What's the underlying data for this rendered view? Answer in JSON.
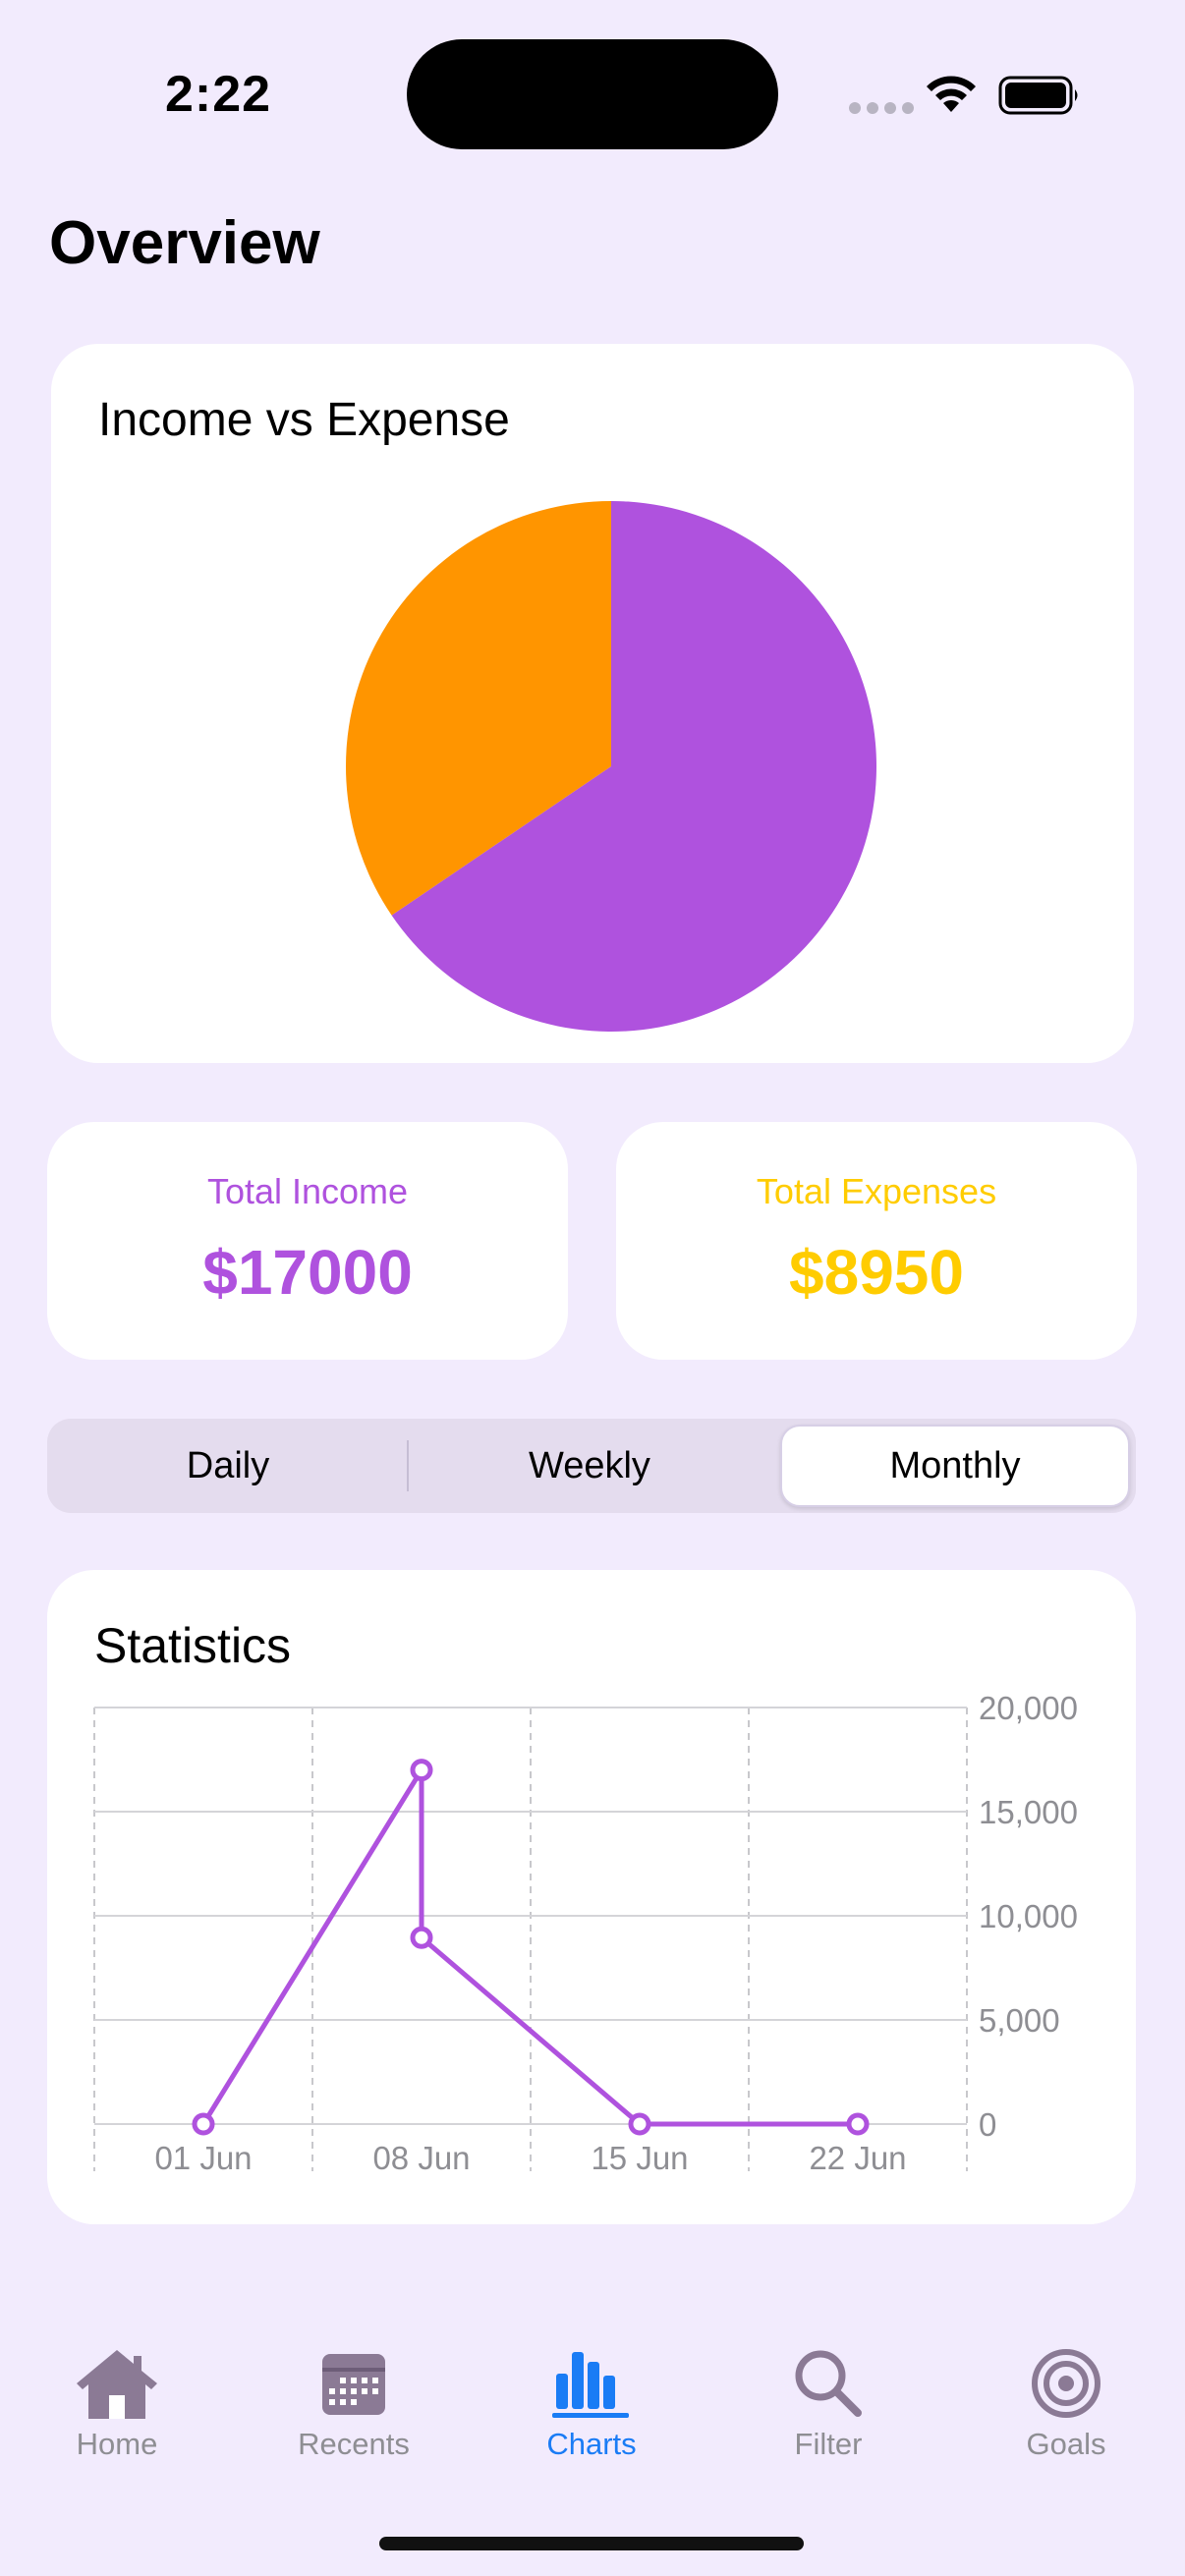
{
  "status_bar": {
    "time": "2:22"
  },
  "page": {
    "title": "Overview"
  },
  "income_vs_expense": {
    "title": "Income vs Expense"
  },
  "totals": {
    "income_label": "Total Income",
    "income_value": "$17000",
    "expense_label": "Total Expenses",
    "expense_value": "$8950"
  },
  "period_selector": {
    "options": [
      "Daily",
      "Weekly",
      "Monthly"
    ],
    "selected": "Monthly"
  },
  "statistics": {
    "title": "Statistics"
  },
  "tabs": [
    {
      "label": "Home",
      "icon": "house-icon"
    },
    {
      "label": "Recents",
      "icon": "calendar-icon"
    },
    {
      "label": "Charts",
      "icon": "bar-chart-icon",
      "active": true
    },
    {
      "label": "Filter",
      "icon": "magnifying-glass-icon"
    },
    {
      "label": "Goals",
      "icon": "target-icon"
    }
  ],
  "colors": {
    "income": "#af52de",
    "expense": "#ff9500",
    "expense_text": "#ffcc00",
    "active_tab": "#1a7cf5"
  },
  "chart_data": [
    {
      "type": "pie",
      "title": "Income vs Expense",
      "slices": [
        {
          "name": "Income",
          "value": 17000,
          "color": "#af52de"
        },
        {
          "name": "Expense",
          "value": 8950,
          "color": "#ff9500"
        }
      ]
    },
    {
      "type": "line",
      "title": "Statistics",
      "x_tick_labels": [
        "01 Jun",
        "08 Jun",
        "15 Jun",
        "22 Jun"
      ],
      "y_tick_labels": [
        "20,000",
        "15,000",
        "10,000",
        "5,000",
        "0"
      ],
      "ylim": [
        0,
        20000
      ],
      "y_axis_position": "right",
      "grid": true,
      "points": [
        {
          "x": "01 Jun",
          "y": 0
        },
        {
          "x": "08 Jun",
          "y": 17000
        },
        {
          "x": "08 Jun",
          "y": 8950
        },
        {
          "x": "15 Jun",
          "y": 0
        },
        {
          "x": "22 Jun",
          "y": 0
        }
      ],
      "color": "#af52de"
    }
  ]
}
